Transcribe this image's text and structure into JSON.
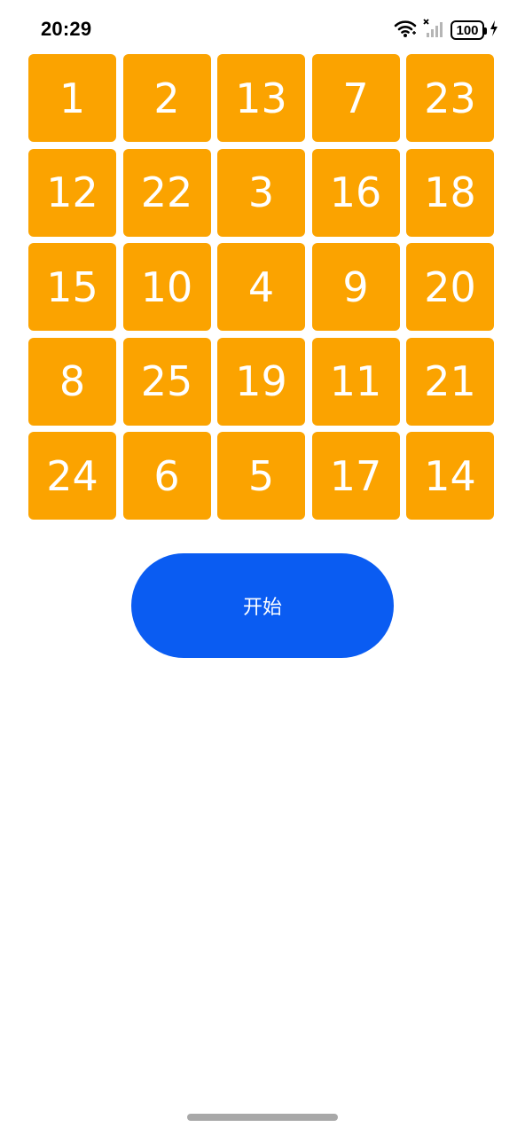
{
  "status_bar": {
    "time": "20:29",
    "battery_level": "100",
    "icons": [
      "wifi-icon",
      "cellular-signal-icon",
      "battery-icon",
      "charging-bolt-icon"
    ]
  },
  "game": {
    "tile_color": "#fba300",
    "tiles": [
      "1",
      "2",
      "13",
      "7",
      "23",
      "12",
      "22",
      "3",
      "16",
      "18",
      "15",
      "10",
      "4",
      "9",
      "20",
      "8",
      "25",
      "19",
      "11",
      "21",
      "24",
      "6",
      "5",
      "17",
      "14"
    ]
  },
  "start_button": {
    "label": "开始",
    "color": "#0a5cf2"
  }
}
